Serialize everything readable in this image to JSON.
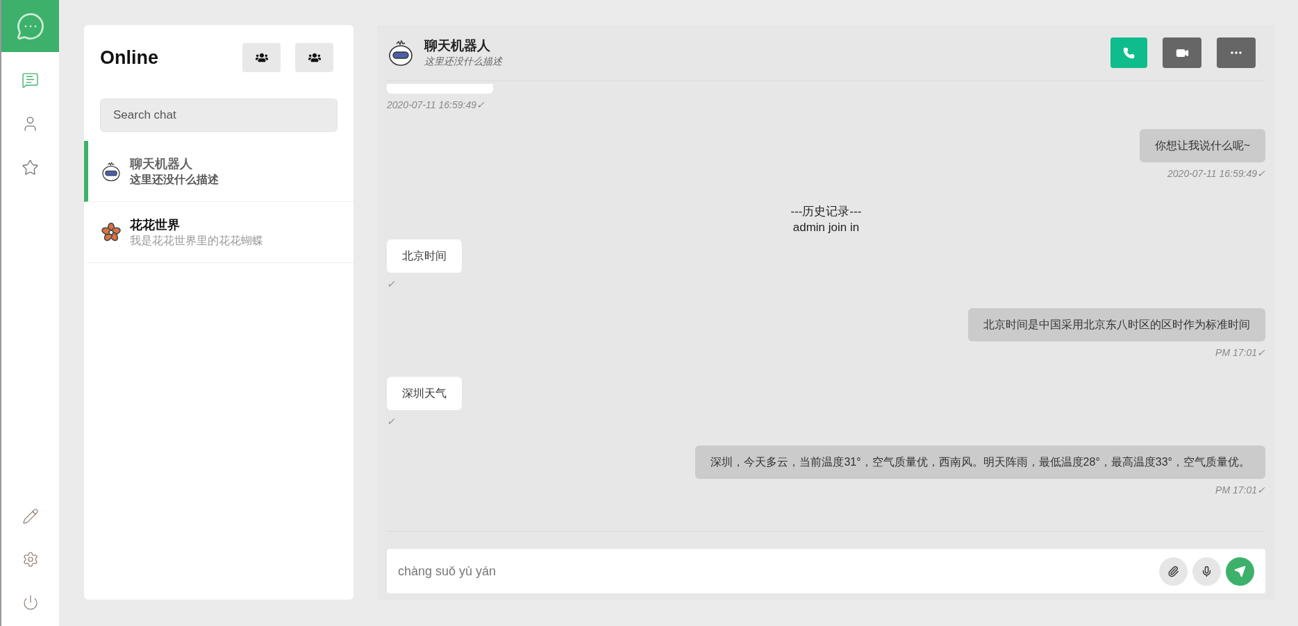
{
  "nav": {
    "items": [
      {
        "kind": "chats",
        "selected": true
      },
      {
        "kind": "contacts",
        "selected": false
      },
      {
        "kind": "favorites",
        "selected": false
      }
    ],
    "bottom": [
      {
        "kind": "edit"
      },
      {
        "kind": "settings"
      },
      {
        "kind": "power"
      }
    ]
  },
  "chat_list": {
    "title": "Online",
    "search": {
      "placeholder": "Search chat"
    },
    "items": [
      {
        "kind": "robot",
        "name": "聊天机器人",
        "preview": "这里还没什么描述",
        "selected": true
      },
      {
        "kind": "flower",
        "name": "花花世界",
        "preview": "我是花花世界里的花花蝴蝶",
        "selected": false
      }
    ]
  },
  "chat": {
    "header": {
      "kind": "robot",
      "name": "聊天机器人",
      "status": "这里还没什么描述"
    },
    "messages": [
      {
        "kind": "received",
        "clipped": true,
        "time": "2020-07-11 16:59:49✓"
      },
      {
        "kind": "sent",
        "text": "你想让我说什么呢~",
        "time": "2020-07-11 16:59:49✓"
      },
      {
        "kind": "system",
        "text": "---历史记录---"
      },
      {
        "kind": "system",
        "text": "admin join in"
      },
      {
        "kind": "received",
        "text": "北京时间",
        "time": "✓"
      },
      {
        "kind": "sent",
        "text": "北京时间是中国采用北京东八时区的区时作为标准时间",
        "time": "PM 17:01✓"
      },
      {
        "kind": "received",
        "text": "深圳天气",
        "time": "✓"
      },
      {
        "kind": "sent",
        "text": "深圳，今天多云，当前温度31°，空气质量优，西南风。明天阵雨，最低温度28°，最高温度33°，空气质量优。",
        "time": "PM 17:01✓"
      }
    ],
    "input": {
      "placeholder": "chàng suǒ yù yán"
    }
  }
}
